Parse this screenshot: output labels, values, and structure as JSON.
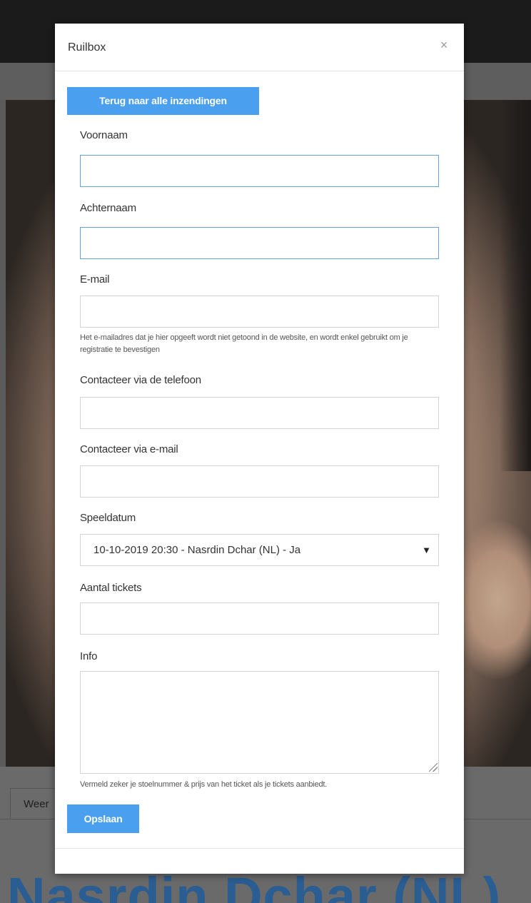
{
  "modal": {
    "title": "Ruilbox",
    "close_icon": "×",
    "back_button": "Terug naar alle inzendingen",
    "save_button": "Opslaan"
  },
  "form": {
    "fields": [
      {
        "label": "Voornaam",
        "value": ""
      },
      {
        "label": "Achternaam",
        "value": ""
      },
      {
        "label": "E-mail",
        "value": "",
        "help": "Het e-mailadres dat je hier opgeeft wordt niet getoond in de website, en wordt enkel gebruikt om je registratie te bevestigen"
      },
      {
        "label": "Contacteer via de telefoon",
        "value": ""
      },
      {
        "label": "Contacteer via e-mail",
        "value": ""
      },
      {
        "label": "Speeldatum",
        "selected": "10-10-2019 20:30 - Nasrdin Dchar (NL) - Ja",
        "arrow_icon": "▼"
      },
      {
        "label": "Aantal tickets",
        "value": ""
      },
      {
        "label": "Info",
        "value": "",
        "help": "Vermeld zeker je stoelnummer & prijs van het ticket als je tickets aanbiedt."
      }
    ]
  },
  "background": {
    "tab_label": "Weer",
    "page_title": "Nasrdin Dchar (NL)"
  },
  "colors": {
    "primary": "#4a9fef",
    "focus_border": "#68a0dd",
    "title_blue": "#2a5d92"
  }
}
